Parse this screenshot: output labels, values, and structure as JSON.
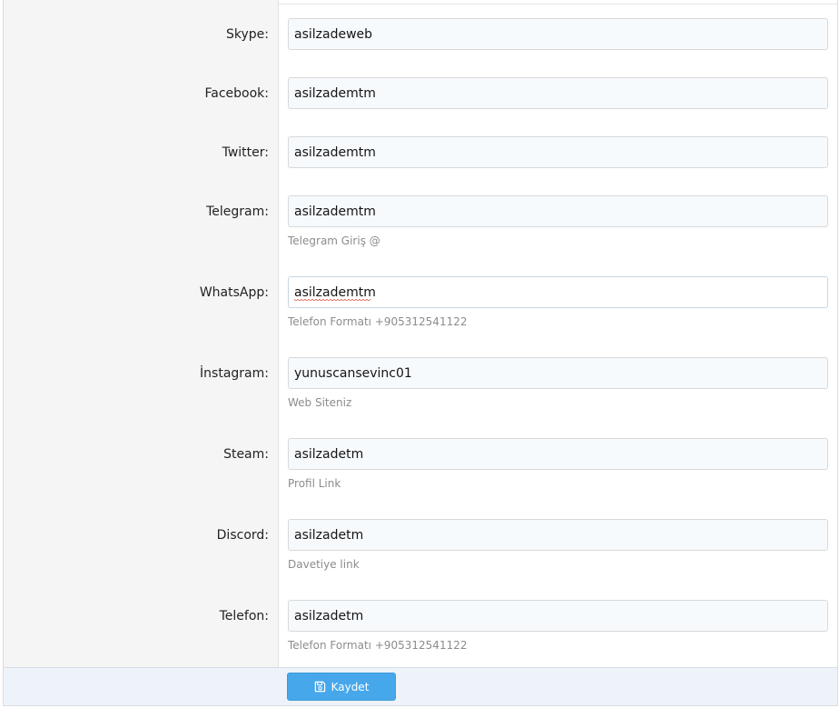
{
  "fields": [
    {
      "label": "Skype:",
      "value": "asilzadeweb",
      "hint": ""
    },
    {
      "label": "Facebook:",
      "value": "asilzademtm",
      "hint": ""
    },
    {
      "label": "Twitter:",
      "value": "asilzademtm",
      "hint": ""
    },
    {
      "label": "Telegram:",
      "value": "asilzademtm",
      "hint": "Telegram Giriş @"
    },
    {
      "label": "WhatsApp:",
      "value": "asilzademtm",
      "hint": "Telefon Formatı +905312541122"
    },
    {
      "label": "İnstagram:",
      "value": "yunuscansevinc01",
      "hint": "Web Siteniz"
    },
    {
      "label": "Steam:",
      "value": "asilzadetm",
      "hint": "Profil Link"
    },
    {
      "label": "Discord:",
      "value": "asilzadetm",
      "hint": "Davetiye link"
    },
    {
      "label": "Telefon:",
      "value": "asilzadetm",
      "hint": "Telefon Formatı +905312541122"
    }
  ],
  "footer": {
    "save_label": "Kaydet",
    "save_icon": "floppy-disk-icon"
  },
  "colors": {
    "button": "#47a7eb",
    "footer_bg": "#edf3f9",
    "label_bg": "#f5f5f5",
    "hint": "#8c8c8c"
  }
}
